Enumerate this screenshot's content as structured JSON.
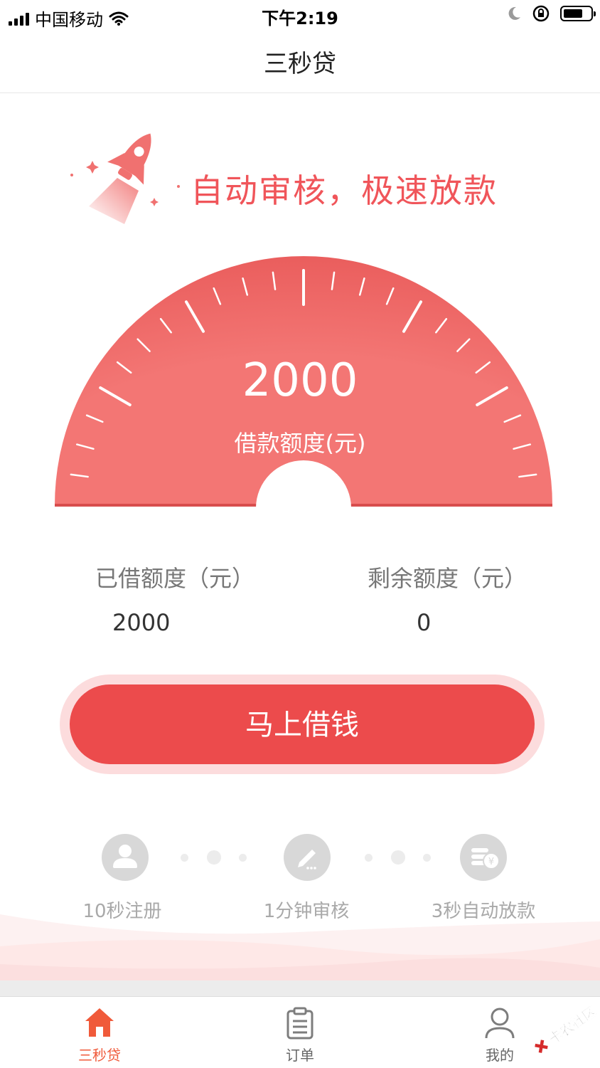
{
  "status_bar": {
    "carrier": "中国移动",
    "time": "下午2:19"
  },
  "nav": {
    "title": "三秒贷"
  },
  "slogan": "自动审核，极速放款",
  "gauge": {
    "amount": "2000",
    "label": "借款额度(元)"
  },
  "stats": {
    "borrowed_label": "已借额度（元）",
    "borrowed_value": "2000",
    "remaining_label": "剩余额度（元）",
    "remaining_value": "0"
  },
  "borrow_button": "马上借钱",
  "steps": [
    {
      "label": "10秒注册",
      "icon": "user-icon"
    },
    {
      "label": "1分钟审核",
      "icon": "pencil-icon"
    },
    {
      "label": "3秒自动放款",
      "icon": "coins-icon"
    }
  ],
  "tabs": [
    {
      "label": "三秒贷",
      "icon": "home-icon",
      "active": true
    },
    {
      "label": "订单",
      "icon": "clipboard-icon",
      "active": false
    },
    {
      "label": "我的",
      "icon": "profile-icon",
      "active": false
    }
  ],
  "watermark": "卡农社区",
  "colors": {
    "accent": "#ec4b4c",
    "gauge": "#f07170",
    "slogan": "#f0555a",
    "tab_active": "#f05a3a",
    "inactive": "#a9a9a9"
  }
}
